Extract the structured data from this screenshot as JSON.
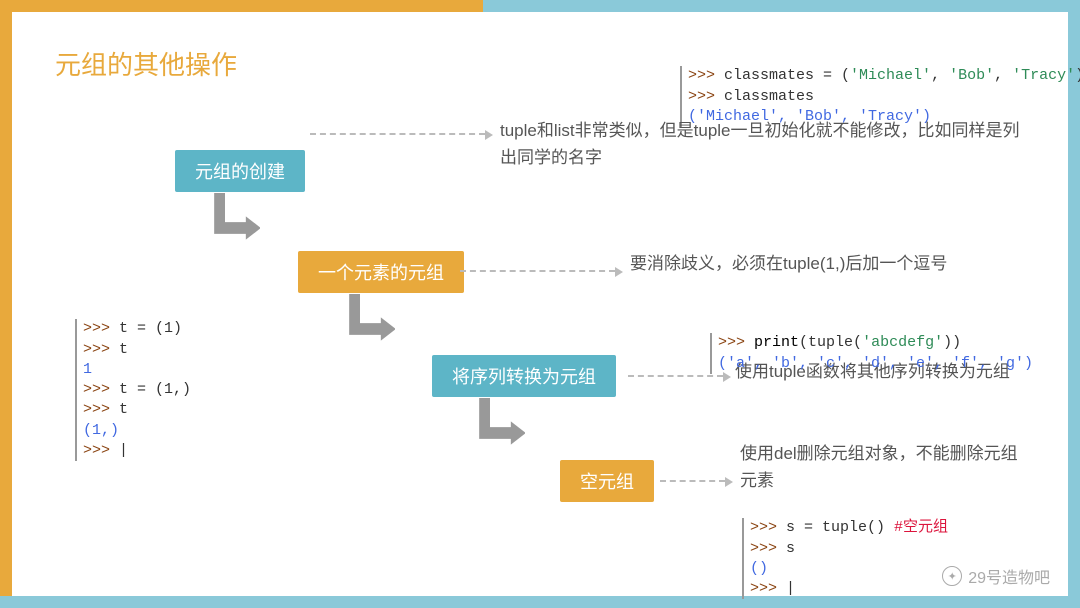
{
  "title": "元组的其他操作",
  "boxes": {
    "b1": "元组的创建",
    "b2": "一个元素的元组",
    "b3": "将序列转换为元组",
    "b4": "空元组"
  },
  "descs": {
    "d1": "tuple和list非常类似，但是tuple一旦初始化就不能修改，比如同样是列出同学的名字",
    "d2": "要消除歧义，必须在tuple(1,)后加一个逗号",
    "d3": "使用tuple函数将其他序列转换为元组",
    "d4": "使用del删除元组对象，不能删除元组元素"
  },
  "code": {
    "c_top_l1": ">>> classmates = ('Michael', 'Bob', 'Tracy')",
    "c_top_l2": ">>> classmates",
    "c_top_l3": "('Michael', 'Bob', 'Tracy')",
    "c_left_l1": ">>> t = (1)",
    "c_left_l2": ">>> t",
    "c_left_l3": "1",
    "c_left_l4": ">>> t = (1,)",
    "c_left_l5": ">>> t",
    "c_left_l6": "(1,)",
    "c_left_l7": ">>> |",
    "c_mid_l1": ">>> print(tuple('abcdefg'))",
    "c_mid_l2": "('a', 'b', 'c', 'd', 'e', 'f', 'g')",
    "c_bot_l1": ">>> s = tuple() #空元组",
    "c_bot_l2": ">>> s",
    "c_bot_l3": "()",
    "c_bot_l4": ">>> |"
  },
  "watermark": "29号造物吧"
}
